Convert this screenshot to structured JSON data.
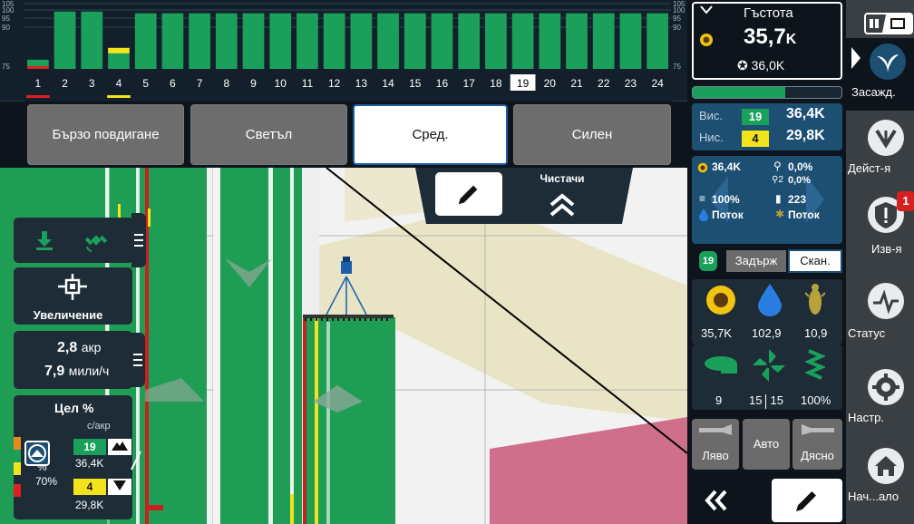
{
  "chart_data": {
    "type": "bar",
    "title": "",
    "categories": [
      "1",
      "2",
      "3",
      "4",
      "5",
      "6",
      "7",
      "8",
      "9",
      "10",
      "11",
      "12",
      "13",
      "14",
      "15",
      "16",
      "17",
      "18",
      "19",
      "20",
      "21",
      "22",
      "23",
      "24"
    ],
    "values": [
      77.5,
      99,
      99,
      81,
      98,
      98,
      98,
      98,
      98,
      98,
      98,
      98,
      98,
      98,
      98,
      98,
      98,
      98,
      98,
      98,
      98,
      98,
      98,
      98
    ],
    "band_colors": [
      "#e02020",
      "#1aa05b",
      "#1aa05b",
      "#f3e31c",
      "#1aa05b",
      "#1aa05b",
      "#1aa05b",
      "#1aa05b",
      "#1aa05b",
      "#1aa05b",
      "#1aa05b",
      "#1aa05b",
      "#1aa05b",
      "#1aa05b",
      "#1aa05b",
      "#1aa05b",
      "#1aa05b",
      "#1aa05b",
      "#1aa05b",
      "#1aa05b",
      "#1aa05b",
      "#1aa05b",
      "#1aa05b",
      "#1aa05b"
    ],
    "selected_row": "19",
    "yticks_left": [
      "105",
      "100",
      "95",
      "90",
      "75"
    ],
    "yticks_right": [
      "105",
      "100",
      "95",
      "90",
      "75"
    ],
    "ylim": [
      75,
      105
    ]
  },
  "downforce": {
    "buttons": [
      "Бързо повдигане",
      "Светъл",
      "Сред.",
      "Силен"
    ],
    "selected": "Сред."
  },
  "map": {
    "wipers_label": "Чистачи",
    "edit_icon": "pencil-icon",
    "colors": {
      "planted": "#1f9d55",
      "unplanted": "#f2f2f2",
      "tan": "#e9e4c6",
      "pink": "#cf6f8b",
      "boundary": "#000000"
    }
  },
  "left_panel": {
    "zoom_label": "Увеличение",
    "area_value": "2,8",
    "area_unit": "акр",
    "speed_value": "7,9",
    "speed_unit": "мили/ч",
    "target_title": "Цел %",
    "target_unit": "с/акр",
    "target_pct_a": "0%",
    "target_pct_b": "%",
    "target_pct_c": "70%",
    "row_hi": "19",
    "row_hi_value": "36,4K",
    "row_lo": "4",
    "row_lo_value": "29,8K"
  },
  "density": {
    "title": "Гъстота",
    "value": "35,7",
    "unit": "K",
    "target": "36,0K",
    "progress_pct": 0.62
  },
  "hilo": {
    "hi_label": "Вис.",
    "hi_row": "19",
    "hi_value": "36,4K",
    "lo_label": "Нис.",
    "lo_row": "4",
    "lo_value": "29,8K"
  },
  "metrics": {
    "seed_value": "36,4K",
    "singulation_value": "0,0%",
    "skips_value": "0,0%",
    "coverage_value": "100%",
    "count_value": "223",
    "flow_left": "Поток",
    "flow_right": "Поток"
  },
  "scan": {
    "row": "19",
    "hold_label": "Задърж",
    "scan_label": "Скан."
  },
  "stats": {
    "seed": "35,7K",
    "water": "102,9",
    "insect": "10,9",
    "sections": "9",
    "fan_a": "15",
    "fan_b": "15",
    "coverage": "100%"
  },
  "markers": {
    "left": "Ляво",
    "auto": "Авто",
    "right": "Дясно"
  },
  "rail": {
    "plant": "Засажд.",
    "actions": "Дейст-я",
    "alerts": "Изв-я",
    "alerts_badge": "1",
    "status": "Статус",
    "settings": "Настр.",
    "home": "Нач...ало"
  }
}
